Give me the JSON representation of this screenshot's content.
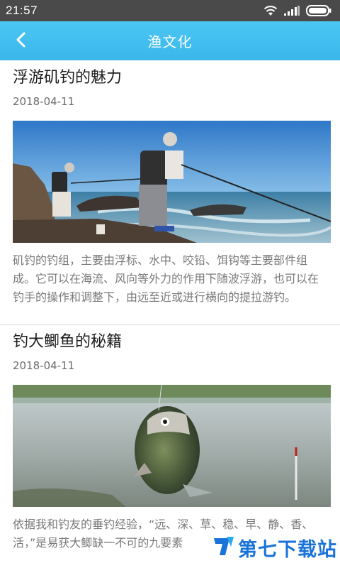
{
  "status_bar": {
    "time": "21:57",
    "icons": [
      "wifi-icon",
      "signal-icon",
      "battery-icon"
    ]
  },
  "app_bar": {
    "title": "渔文化",
    "back_icon": "chevron-left-icon",
    "background": "#3ab6ea"
  },
  "articles": [
    {
      "title": "浮游矶钓的魅力",
      "date": "2018-04-11",
      "image": "photo: anglers fishing from rocky shore",
      "text": "矶钓的钓组，主要由浮标、水中、咬铅、饵钩等主要部件组成。它可以在海流、风向等外力的作用下随波浮游，也可以在钓手的操作和调整下，由远至近或进行横向的提拉游钓。"
    },
    {
      "title": "钓大鲫鱼的秘籍",
      "date": "2018-04-11",
      "image": "photo: hooked crucian carp above water",
      "text": "依据我和钓友的垂钓经验，“远、深、草、稳、早、静、香、活，”是易获大鲫缺一不可的九要素"
    }
  ],
  "watermark": {
    "text": "第七下载站",
    "logo": "download-site-logo"
  }
}
